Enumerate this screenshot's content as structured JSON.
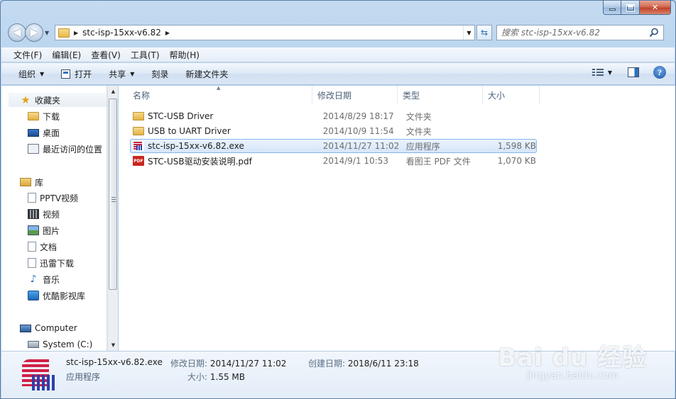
{
  "window": {
    "address": "stc-isp-15xx-v6.82",
    "search_placeholder": "搜索 stc-isp-15xx-v6.82"
  },
  "menu": [
    "文件(F)",
    "编辑(E)",
    "查看(V)",
    "工具(T)",
    "帮助(H)"
  ],
  "toolbar": {
    "organize": "组织",
    "open": "打开",
    "share": "共享",
    "burn": "刻录",
    "new_folder": "新建文件夹"
  },
  "nav": {
    "favorites": "收藏夹",
    "downloads": "下载",
    "desktop": "桌面",
    "recent": "最近访问的位置",
    "libraries": "库",
    "pptv": "PPTV视频",
    "videos": "视频",
    "pictures": "图片",
    "documents": "文档",
    "xunlei": "迅雷下载",
    "music": "音乐",
    "youku": "优酷影视库",
    "computer": "Computer",
    "system_c": "System (C:)"
  },
  "columns": {
    "name": "名称",
    "date": "修改日期",
    "type": "类型",
    "size": "大小"
  },
  "files": [
    {
      "name": "STC-USB Driver",
      "date": "2014/8/29 18:17",
      "type": "文件夹",
      "size": "",
      "icon": "folder-icon"
    },
    {
      "name": "USB to UART Driver",
      "date": "2014/10/9 11:54",
      "type": "文件夹",
      "size": "",
      "icon": "folder-icon"
    },
    {
      "name": "stc-isp-15xx-v6.82.exe",
      "date": "2014/11/27 11:02",
      "type": "应用程序",
      "size": "1,598 KB",
      "icon": "stc-app-icon"
    },
    {
      "name": "STC-USB驱动安装说明.pdf",
      "date": "2014/9/1 10:53",
      "type": "看图王 PDF 文件",
      "size": "1,070 KB",
      "icon": "pdf-icon"
    }
  ],
  "details": {
    "name": "stc-isp-15xx-v6.82.exe",
    "type": "应用程序",
    "modified_label": "修改日期:",
    "modified": "2014/11/27 11:02",
    "size_label": "大小:",
    "size": "1.55 MB",
    "created_label": "创建日期:",
    "created": "2018/6/11 23:18"
  },
  "watermark": {
    "main": "Bai du 经验",
    "sub": "jingyan.baidu.com"
  },
  "colors": {
    "selection_border": "#86b6e9",
    "selection_fill": "#d5e6fa",
    "window_chrome": "#b6d2ee"
  }
}
